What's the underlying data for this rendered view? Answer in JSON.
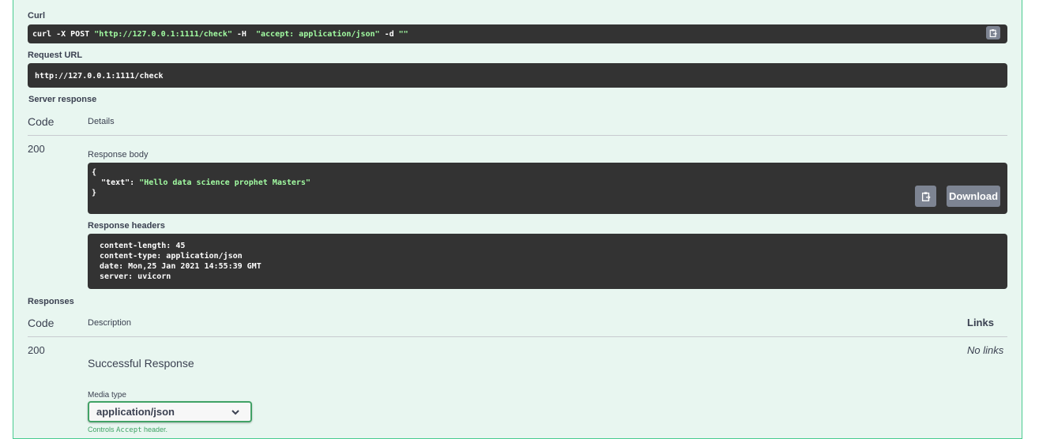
{
  "curl": {
    "label": "Curl",
    "command_prefix": "curl -X POST ",
    "url_quoted": "\"http://127.0.0.1:1111/check\"",
    "flag_h": " -H  ",
    "header_quoted": "\"accept: application/json\"",
    "flag_d": " -d ",
    "data_quoted": "\"\""
  },
  "request_url": {
    "label": "Request URL",
    "value": "http://127.0.0.1:1111/check"
  },
  "server_response": {
    "label": "Server response",
    "col_code": "Code",
    "col_details": "Details",
    "code": "200",
    "body_label": "Response body",
    "body_open": "{",
    "body_key": "  \"text\"",
    "body_colon": ": ",
    "body_value": "\"Hello data science prophet Masters\"",
    "body_close": "}",
    "download_label": "Download",
    "headers_label": "Response headers",
    "headers": [
      " content-length: 45",
      " content-type: application/json",
      " date: Mon,25 Jan 2021 14:55:39 GMT",
      " server: uvicorn"
    ]
  },
  "responses": {
    "label": "Responses",
    "col_code": "Code",
    "col_description": "Description",
    "col_links": "Links",
    "code": "200",
    "description": "Successful Response",
    "links": "No links",
    "media_type_label": "Media type",
    "media_type_value": "application/json",
    "controls_prefix": "Controls ",
    "controls_code": "Accept",
    "controls_suffix": " header."
  },
  "icons": {
    "copy": "clipboard-icon",
    "chevron": "chevron-down-icon"
  },
  "colors": {
    "panel_bg": "#e8f6f0",
    "panel_border": "#49cc90",
    "code_bg": "#333333",
    "string_green": "#a2fca2",
    "button_gray": "#7d8492",
    "select_border": "#41a266"
  }
}
